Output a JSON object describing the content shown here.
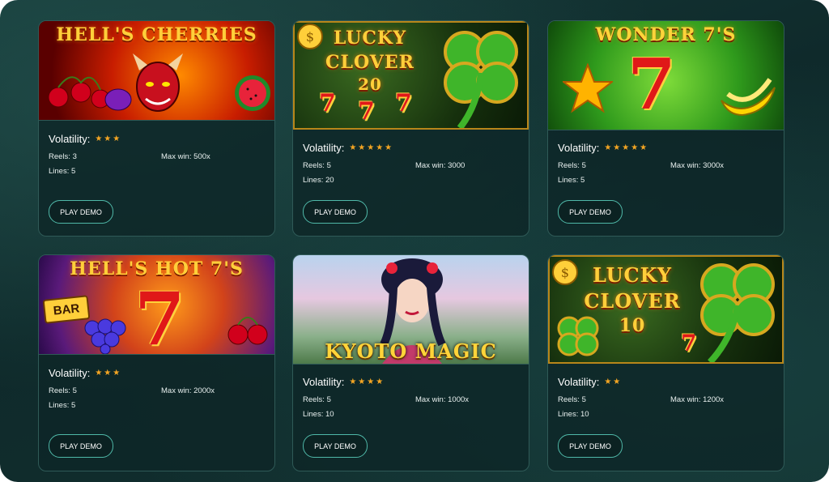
{
  "games": [
    {
      "title": "HELL'S CHERRIES",
      "volatility_label": "Volatility:",
      "volatility_stars": "★★★",
      "reels_label": "Reels",
      "reels": "3",
      "maxwin_label": "Max win",
      "maxwin": "500x",
      "lines_label": "Lines",
      "lines": "5",
      "button": "PLAY DEMO"
    },
    {
      "title_line1": "LUCKY",
      "title_line2": "CLOVER",
      "title_line3": "20",
      "volatility_label": "Volatility:",
      "volatility_stars": "★★★★★",
      "reels_label": "Reels",
      "reels": "5",
      "maxwin_label": "Max win",
      "maxwin": "3000",
      "lines_label": "Lines",
      "lines": "20",
      "button": "PLAY DEMO"
    },
    {
      "title": "WONDER 7'S",
      "volatility_label": "Volatility:",
      "volatility_stars": "★★★★★",
      "reels_label": "Reels",
      "reels": "5",
      "maxwin_label": "Max win",
      "maxwin": "3000x",
      "lines_label": "Lines",
      "lines": "5",
      "button": "PLAY DEMO"
    },
    {
      "title": "HELL'S HOT 7'S",
      "badge": "BAR",
      "volatility_label": "Volatility:",
      "volatility_stars": "★★★",
      "reels_label": "Reels",
      "reels": "5",
      "maxwin_label": "Max win",
      "maxwin": "2000x",
      "lines_label": "Lines",
      "lines": "5",
      "button": "PLAY DEMO"
    },
    {
      "title": "KYOTO MAGIC",
      "volatility_label": "Volatility:",
      "volatility_stars": "★★★★",
      "reels_label": "Reels",
      "reels": "5",
      "maxwin_label": "Max win",
      "maxwin": "1000x",
      "lines_label": "Lines",
      "lines": "10",
      "button": "PLAY DEMO"
    },
    {
      "title_line1": "LUCKY",
      "title_line2": "CLOVER",
      "title_line3": "10",
      "volatility_label": "Volatility:",
      "volatility_stars": "★★",
      "reels_label": "Reels",
      "reels": "5",
      "maxwin_label": "Max win",
      "maxwin": "1200x",
      "lines_label": "Lines",
      "lines": "10",
      "button": "PLAY DEMO"
    }
  ],
  "colors": {
    "accent_gold": "#ffcf3a",
    "star": "#f5a623",
    "button_border": "#4fb8a8"
  }
}
